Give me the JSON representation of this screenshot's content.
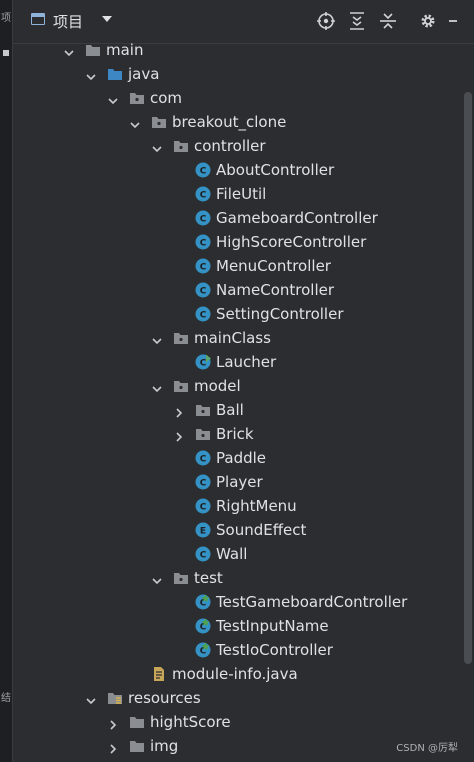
{
  "header": {
    "title": "项目"
  },
  "sidebar": {
    "top_text": "项",
    "bottom_text": "结"
  },
  "tree": [
    {
      "label": "main",
      "type": "folder",
      "depth": 0,
      "expanded": true
    },
    {
      "label": "java",
      "type": "src-folder",
      "depth": 1,
      "expanded": true
    },
    {
      "label": "com",
      "type": "package",
      "depth": 2,
      "expanded": true
    },
    {
      "label": "breakout_clone",
      "type": "package",
      "depth": 3,
      "expanded": true
    },
    {
      "label": "controller",
      "type": "package",
      "depth": 4,
      "expanded": true
    },
    {
      "label": "AboutController",
      "type": "class",
      "depth": 5
    },
    {
      "label": "FileUtil",
      "type": "class",
      "depth": 5
    },
    {
      "label": "GameboardController",
      "type": "class",
      "depth": 5
    },
    {
      "label": "HighScoreController",
      "type": "class",
      "depth": 5
    },
    {
      "label": "MenuController",
      "type": "class",
      "depth": 5
    },
    {
      "label": "NameController",
      "type": "class",
      "depth": 5
    },
    {
      "label": "SettingController",
      "type": "class",
      "depth": 5
    },
    {
      "label": "mainClass",
      "type": "package",
      "depth": 4,
      "expanded": true
    },
    {
      "label": "Laucher",
      "type": "main-class",
      "depth": 5
    },
    {
      "label": "model",
      "type": "package",
      "depth": 4,
      "expanded": true
    },
    {
      "label": "Ball",
      "type": "package",
      "depth": 5,
      "expanded": false
    },
    {
      "label": "Brick",
      "type": "package",
      "depth": 5,
      "expanded": false
    },
    {
      "label": "Paddle",
      "type": "class",
      "depth": 5
    },
    {
      "label": "Player",
      "type": "class",
      "depth": 5
    },
    {
      "label": "RightMenu",
      "type": "class",
      "depth": 5
    },
    {
      "label": "SoundEffect",
      "type": "enum",
      "depth": 5
    },
    {
      "label": "Wall",
      "type": "class",
      "depth": 5
    },
    {
      "label": "test",
      "type": "package",
      "depth": 4,
      "expanded": true
    },
    {
      "label": "TestGameboardController",
      "type": "test-class",
      "depth": 5
    },
    {
      "label": "TestInputName",
      "type": "test-class",
      "depth": 5
    },
    {
      "label": "TestIoController",
      "type": "test-class",
      "depth": 5
    },
    {
      "label": "module-info.java",
      "type": "module-file",
      "depth": 3
    },
    {
      "label": "resources",
      "type": "res-folder",
      "depth": 1,
      "expanded": true
    },
    {
      "label": "hightScore",
      "type": "folder",
      "depth": 2,
      "expanded": false
    },
    {
      "label": "img",
      "type": "folder",
      "depth": 2,
      "expanded": false
    }
  ],
  "watermark": "CSDN @厉犁",
  "colors": {
    "class": "#3592c4",
    "folder": "#8a8d92",
    "src_folder": "#3d87c4",
    "test_badge": "#4fa34a",
    "main_badge": "#59a869"
  }
}
